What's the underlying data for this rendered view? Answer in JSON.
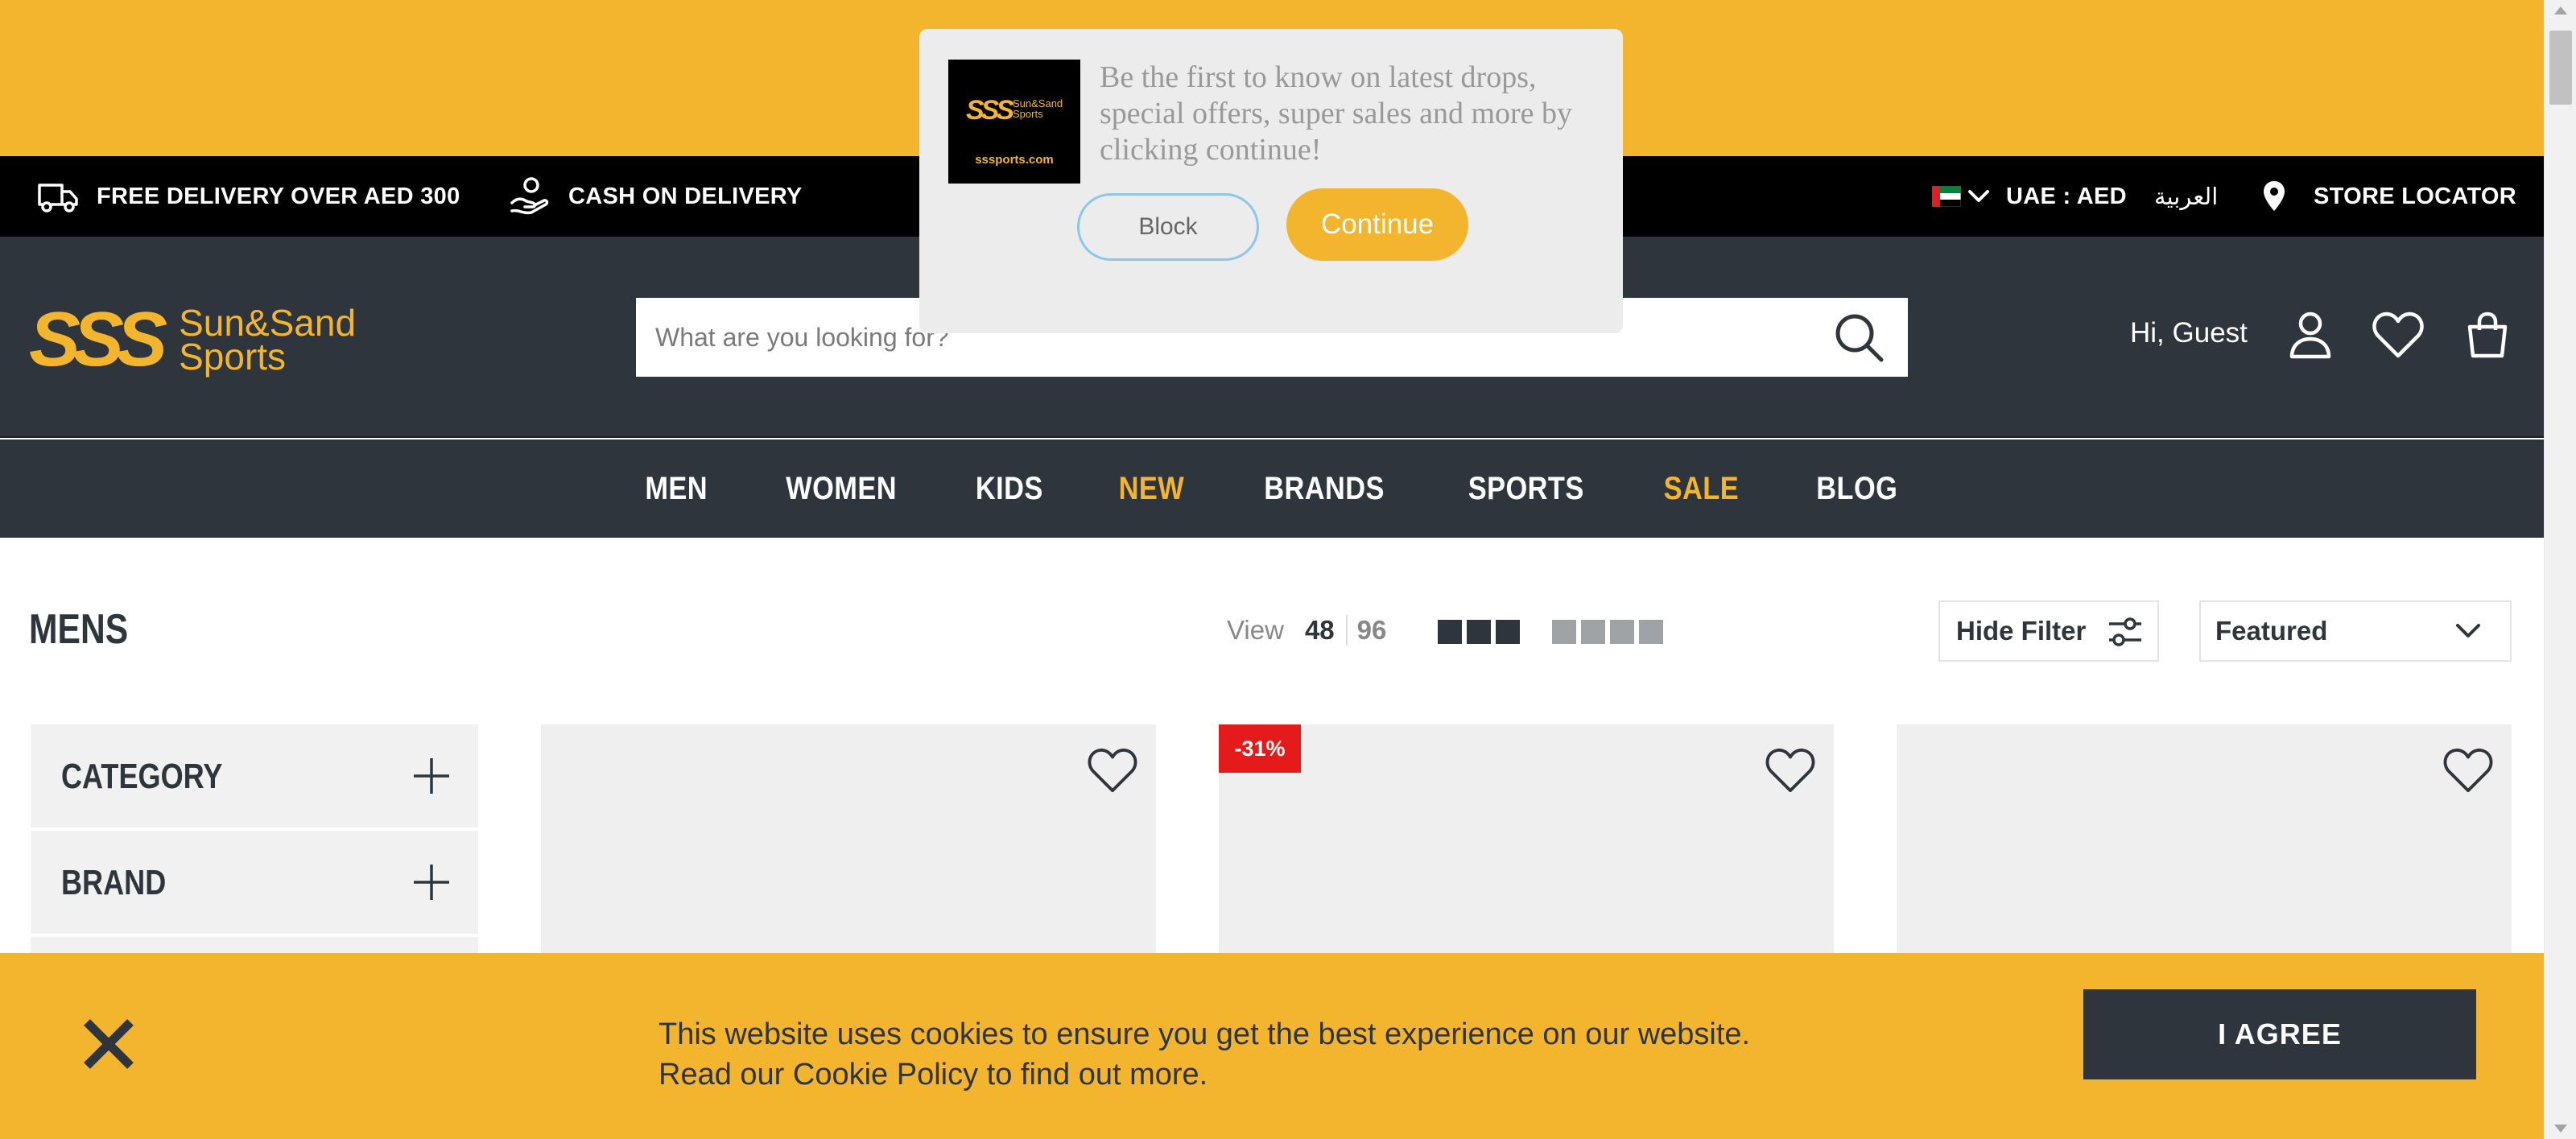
{
  "colors": {
    "brand_yellow": "#f4b52e",
    "header_dark": "#2e353c",
    "black": "#000000",
    "sale_red": "#e51b1b",
    "card_bg": "#efefef"
  },
  "infobar": {
    "free_delivery": "FREE DELIVERY OVER AED 300",
    "cash_on_delivery": "CASH ON DELIVERY",
    "currency": "UAE : AED",
    "language": "العربية",
    "store_locator": "STORE LOCATOR",
    "icons": [
      "truck-icon",
      "hand-coin-icon",
      "uae-flag-icon",
      "chevron-down-icon",
      "location-pin-icon"
    ]
  },
  "header": {
    "logo_marks": "SSS",
    "logo_line1": "Sun&Sand",
    "logo_line2": "Sports",
    "search_placeholder": "What are you looking for?",
    "greeting": "Hi, Guest",
    "icons": [
      "search-icon",
      "user-icon",
      "heart-icon",
      "shopping-bag-icon"
    ]
  },
  "nav": {
    "items": [
      {
        "label": "MEN",
        "highlight": false
      },
      {
        "label": "WOMEN",
        "highlight": false
      },
      {
        "label": "KIDS",
        "highlight": false
      },
      {
        "label": "NEW",
        "highlight": true
      },
      {
        "label": "BRANDS",
        "highlight": false
      },
      {
        "label": "SPORTS",
        "highlight": false
      },
      {
        "label": "SALE",
        "highlight": true
      },
      {
        "label": "BLOG",
        "highlight": false
      }
    ]
  },
  "listing": {
    "title": "MENS",
    "view_label": "View",
    "page_sizes": [
      "48",
      "96"
    ],
    "selected_page_size": "48",
    "hide_filter": "Hide Filter",
    "sort_selected": "Featured"
  },
  "filters": [
    {
      "label": "CATEGORY"
    },
    {
      "label": "BRAND"
    }
  ],
  "products": [
    {
      "badge": ""
    },
    {
      "badge": "-31%"
    },
    {
      "badge": ""
    }
  ],
  "popup": {
    "logo_marks": "SSS",
    "logo_line1": "Sun&Sand",
    "logo_line2": "Sports",
    "logo_url": "sssports.com",
    "message": "Be the first to know on latest drops, special offers, super sales and more by clicking continue!",
    "block_label": "Block",
    "continue_label": "Continue"
  },
  "cookie": {
    "line1": "This website uses cookies to ensure you get the best experience on our website.",
    "line2": "Read our Cookie Policy to find out more.",
    "agree_label": "I AGREE"
  }
}
